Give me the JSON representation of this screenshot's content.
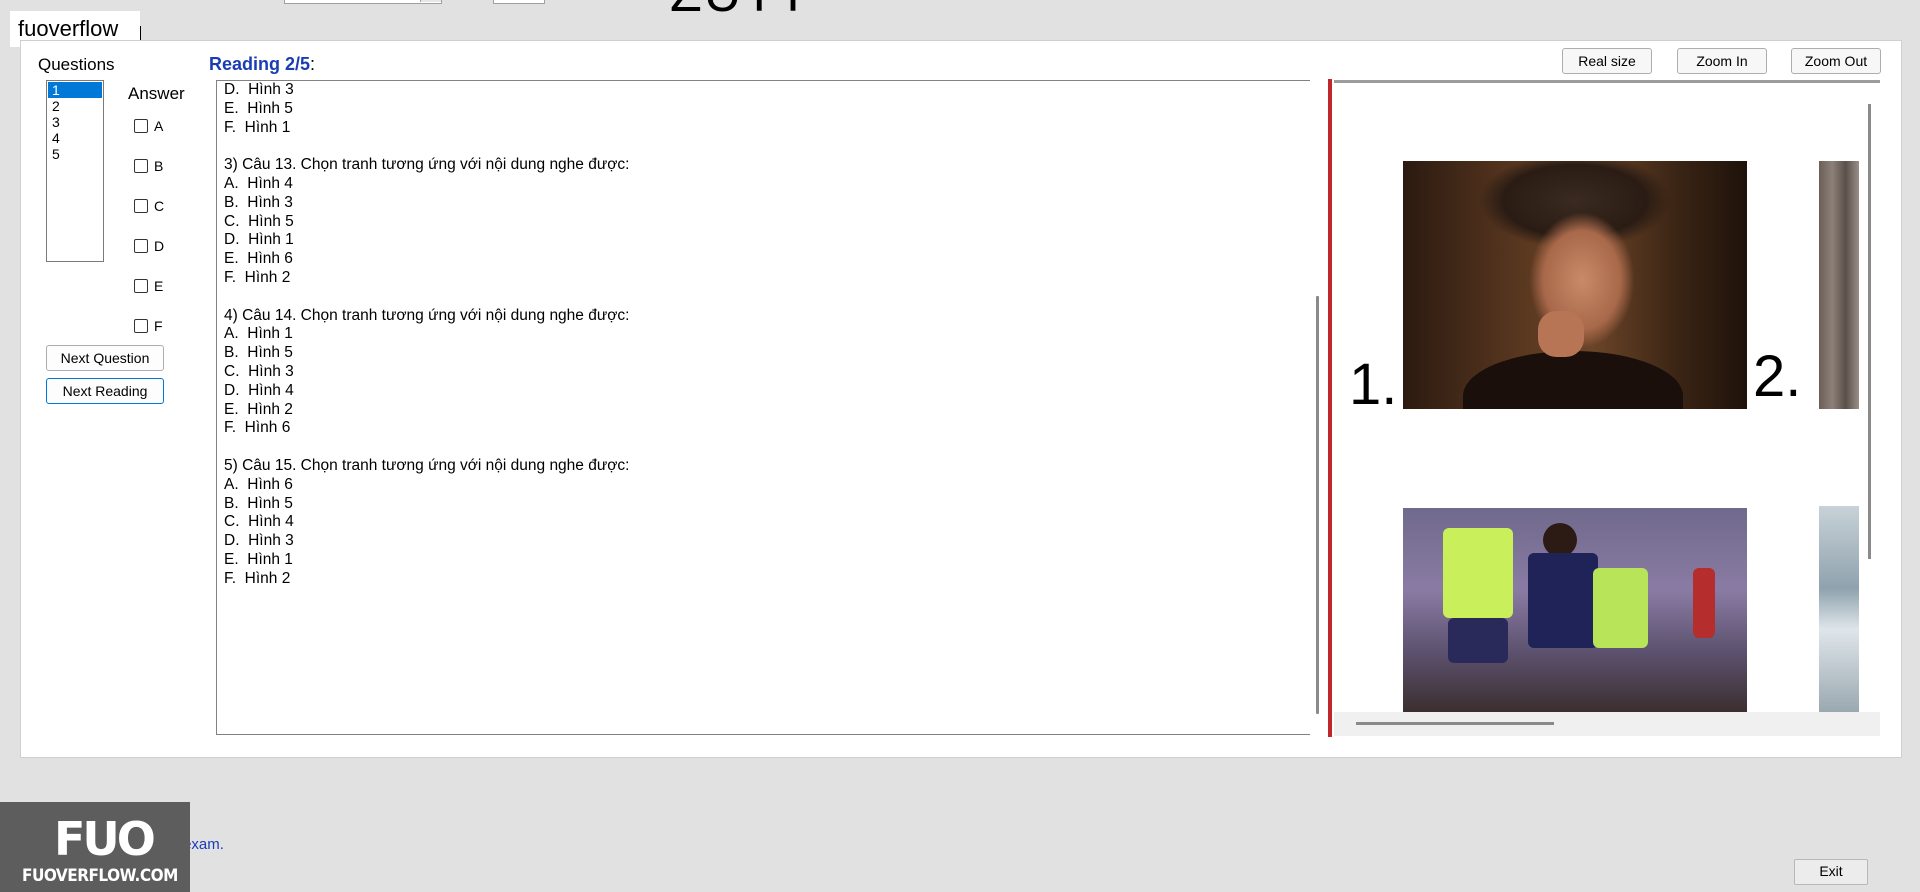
{
  "header": {
    "brand": "fuoverflow",
    "big_text_clipped": "ZUTT"
  },
  "sidebar": {
    "questions_label": "Questions",
    "questions": [
      "1",
      "2",
      "3",
      "4",
      "5"
    ],
    "selected_question": "1",
    "answer_label": "Answer",
    "answers": [
      "A",
      "B",
      "C",
      "D",
      "E",
      "F"
    ],
    "next_question_label": "Next Question",
    "next_reading_label": "Next Reading"
  },
  "reading": {
    "title": "Reading 2/5",
    "colon": ":",
    "text": "D.  Hình 3\nE.  Hình 5\nF.  Hình 1\n\n3) Câu 13. Chọn tranh tương ứng với nội dung nghe được:\nA.  Hình 4\nB.  Hình 3\nC.  Hình 5\nD.  Hình 1\nE.  Hình 6\nF.  Hình 2\n\n4) Câu 14. Chọn tranh tương ứng với nội dung nghe được:\nA.  Hình 1\nB.  Hình 5\nC.  Hình 3\nD.  Hình 4\nE.  Hình 2\nF.  Hình 6\n\n5) Câu 15. Chọn tranh tương ứng với nội dung nghe được:\nA.  Hình 6\nB.  Hình 5\nC.  Hình 4\nD.  Hình 3\nE.  Hình 1\nF.  Hình 2"
  },
  "viewer": {
    "real_size_label": "Real size",
    "zoom_in_label": "Zoom In",
    "zoom_out_label": "Zoom Out",
    "image_label_1": "1.",
    "image_label_2": "2."
  },
  "footer": {
    "logo_text": "FUO",
    "logo_url": "FUOVERFLOW.COM",
    "finish_label": "I want to finish the exam.",
    "exit_label": "Exit"
  }
}
